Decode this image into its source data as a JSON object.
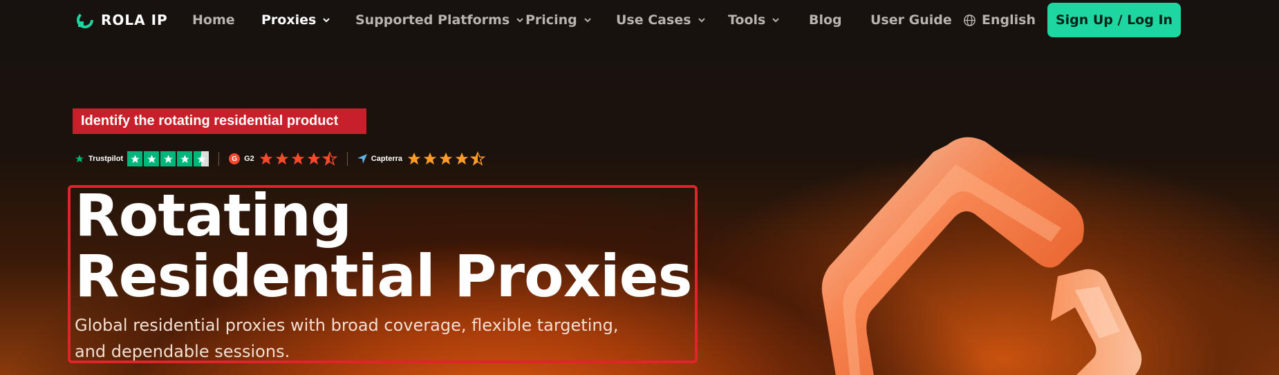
{
  "brand": {
    "name": "ROLA IP"
  },
  "nav": {
    "items": [
      {
        "label": "Home",
        "dropdown": false,
        "active": false
      },
      {
        "label": "Proxies",
        "dropdown": true,
        "active": true
      },
      {
        "label": "Supported Platforms",
        "dropdown": true,
        "active": false
      },
      {
        "label": "Pricing",
        "dropdown": true,
        "active": false
      },
      {
        "label": "Use Cases",
        "dropdown": true,
        "active": false
      },
      {
        "label": "Tools",
        "dropdown": true,
        "active": false
      },
      {
        "label": "Blog",
        "dropdown": false,
        "active": false
      },
      {
        "label": "User Guide",
        "dropdown": false,
        "active": false
      }
    ],
    "language": "English",
    "cta_label": "Sign Up / Log In"
  },
  "annotation": {
    "label": "Identify the rotating residential product",
    "color": "#c8202a"
  },
  "ratings": [
    {
      "source": "Trustpilot",
      "stars": 4.5
    },
    {
      "source": "G2",
      "stars": 4.5
    },
    {
      "source": "Capterra",
      "stars": 4.5
    }
  ],
  "hero": {
    "title_line1": "Rotating",
    "title_line2": "Residential Proxies",
    "subtitle_line1": "Global residential proxies with broad coverage, flexible targeting,",
    "subtitle_line2": "and dependable sessions."
  },
  "colors": {
    "accent": "#1ed6a0",
    "highlight": "#e0242c",
    "trustpilot": "#00b67a",
    "rating_orange": "#ff6a1a"
  }
}
